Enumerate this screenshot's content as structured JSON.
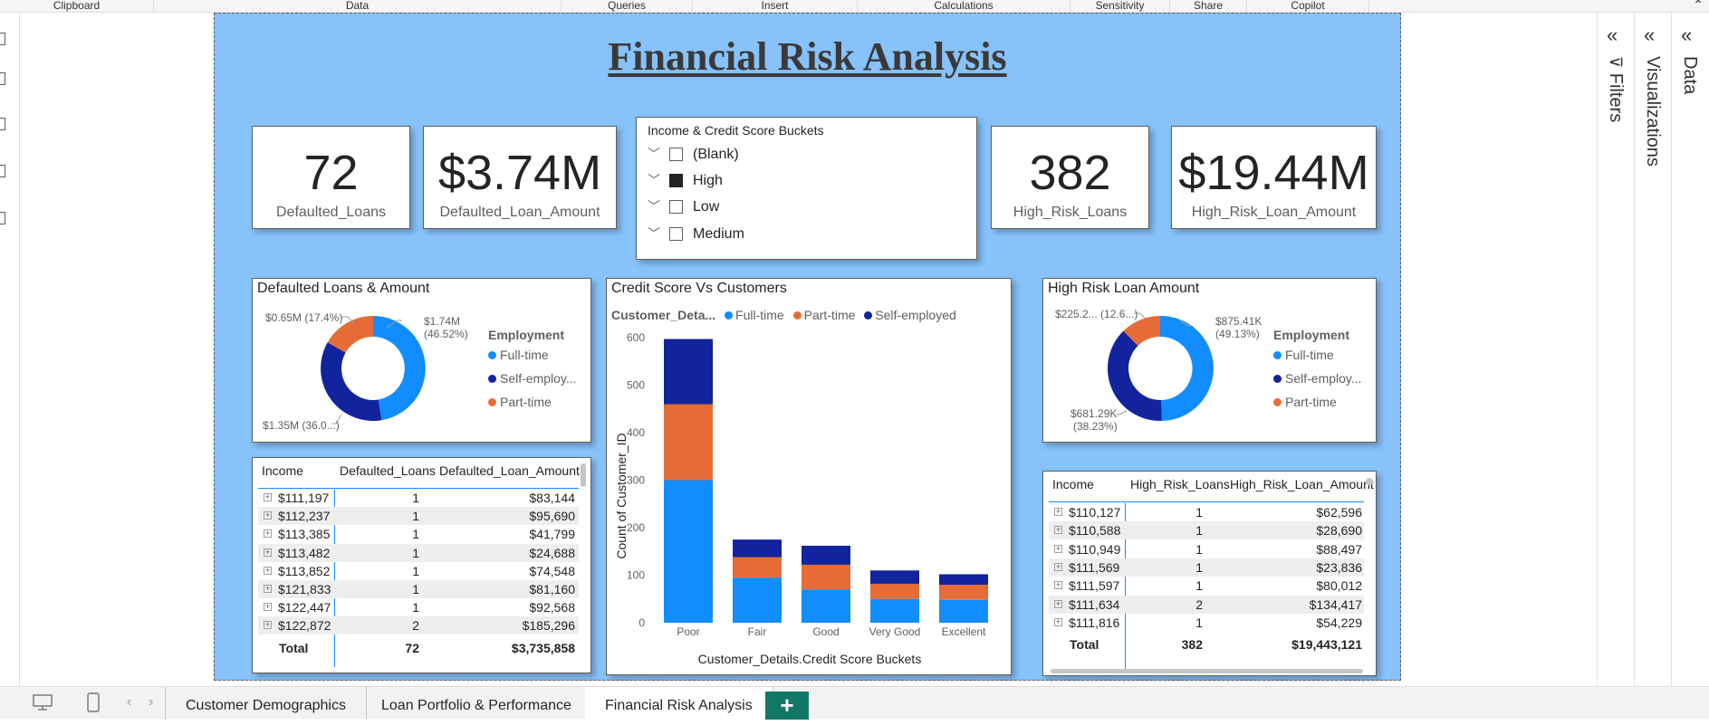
{
  "ribbon": {
    "groups": [
      "Clipboard",
      "Data",
      "Queries",
      "Insert",
      "Calculations",
      "Sensitivity",
      "Share",
      "Copilot"
    ],
    "collapse_icon": "chevron-up-icon"
  },
  "report": {
    "title": "Financial Risk Analysis",
    "background": "#87c2fb"
  },
  "kpis": [
    {
      "value": "72",
      "label": "Defaulted_Loans"
    },
    {
      "value": "$3.74M",
      "label": "Defaulted_Loan_Amount"
    },
    {
      "value": "382",
      "label": "High_Risk_Loans"
    },
    {
      "value": "$19.44M",
      "label": "High_Risk_Loan_Amount"
    }
  ],
  "slicer": {
    "title": "Income & Credit Score Buckets",
    "items": [
      {
        "label": "(Blank)",
        "checked": false
      },
      {
        "label": "High",
        "checked": true
      },
      {
        "label": "Low",
        "checked": false
      },
      {
        "label": "Medium",
        "checked": false
      }
    ]
  },
  "colors": {
    "full_time": "#118dff",
    "self_employed": "#12239e",
    "part_time": "#e66c37"
  },
  "donut_defaulted": {
    "title": "Defaulted Loans & Amount",
    "legend_title": "Employment",
    "legend": [
      "Full-time",
      "Self-employ...",
      "Part-time"
    ],
    "labels": {
      "full_time": [
        "$1.74M",
        "(46.52%)"
      ],
      "self_employed": [
        "$1.35M (36.0...)"
      ],
      "part_time": [
        "$0.65M (17.4%)"
      ]
    }
  },
  "donut_highrisk": {
    "title": "High Risk Loan Amount",
    "legend_title": "Employment",
    "legend": [
      "Full-time",
      "Self-employ...",
      "Part-time"
    ],
    "labels": {
      "full_time": [
        "$875.41K",
        "(49.13%)"
      ],
      "self_employed": [
        "$681.29K",
        "(38.23%)"
      ],
      "part_time": [
        "$225.2... (12.6...)"
      ]
    }
  },
  "table_defaulted": {
    "headers": [
      "Income",
      "Defaulted_Loans",
      "Defaulted_Loan_Amount"
    ],
    "rows": [
      [
        "$111,197",
        "1",
        "$83,144"
      ],
      [
        "$112,237",
        "1",
        "$95,690"
      ],
      [
        "$113,385",
        "1",
        "$41,799"
      ],
      [
        "$113,482",
        "1",
        "$24,688"
      ],
      [
        "$113,852",
        "1",
        "$74,548"
      ],
      [
        "$121,833",
        "1",
        "$81,160"
      ],
      [
        "$122,447",
        "1",
        "$92,568"
      ],
      [
        "$122,872",
        "2",
        "$185,296"
      ]
    ],
    "total": [
      "Total",
      "72",
      "$3,735,858"
    ]
  },
  "table_highrisk": {
    "headers": [
      "Income",
      "High_Risk_Loans",
      "High_Risk_Loan_Amount"
    ],
    "rows": [
      [
        "$110,127",
        "1",
        "$62,596"
      ],
      [
        "$110,588",
        "1",
        "$28,690"
      ],
      [
        "$110,949",
        "1",
        "$88,497"
      ],
      [
        "$111,569",
        "1",
        "$23,836"
      ],
      [
        "$111,597",
        "1",
        "$80,012"
      ],
      [
        "$111,634",
        "2",
        "$134,417"
      ],
      [
        "$111,816",
        "1",
        "$54,229"
      ]
    ],
    "total": [
      "Total",
      "382",
      "$19,443,121"
    ]
  },
  "chart_data": {
    "type": "bar",
    "stacked": true,
    "title": "Credit Score Vs Customers",
    "legend_title": "Customer_Deta...",
    "categories": [
      "Poor",
      "Fair",
      "Good",
      "Very Good",
      "Excellent"
    ],
    "series": [
      {
        "name": "Full-time",
        "color": "#118dff",
        "values": [
          300,
          95,
          70,
          50,
          48
        ]
      },
      {
        "name": "Part-time",
        "color": "#e66c37",
        "values": [
          160,
          43,
          52,
          32,
          32
        ]
      },
      {
        "name": "Self-employed",
        "color": "#12239e",
        "values": [
          137,
          37,
          40,
          28,
          22
        ]
      }
    ],
    "xlabel": "Customer_Details.Credit Score Buckets",
    "ylabel": "Count of Customer_ID",
    "yticks": [
      "0",
      "100",
      "200",
      "300",
      "400",
      "500",
      "600"
    ],
    "ylim": [
      0,
      600
    ],
    "grid": false,
    "legend_position": "top"
  },
  "panes": [
    {
      "label": "Filters",
      "icon": "chevron-double-left-icon"
    },
    {
      "label": "Visualizations",
      "icon": "chevron-double-left-icon"
    },
    {
      "label": "Data",
      "icon": "chevron-double-left-icon"
    }
  ],
  "tabs": {
    "pages": [
      "Customer Demographics",
      "Loan Portfolio & Performance",
      "Financial Risk Analysis"
    ],
    "active": "Financial Risk Analysis",
    "add_label": "+",
    "nav_prev": "‹",
    "nav_next": "›"
  }
}
